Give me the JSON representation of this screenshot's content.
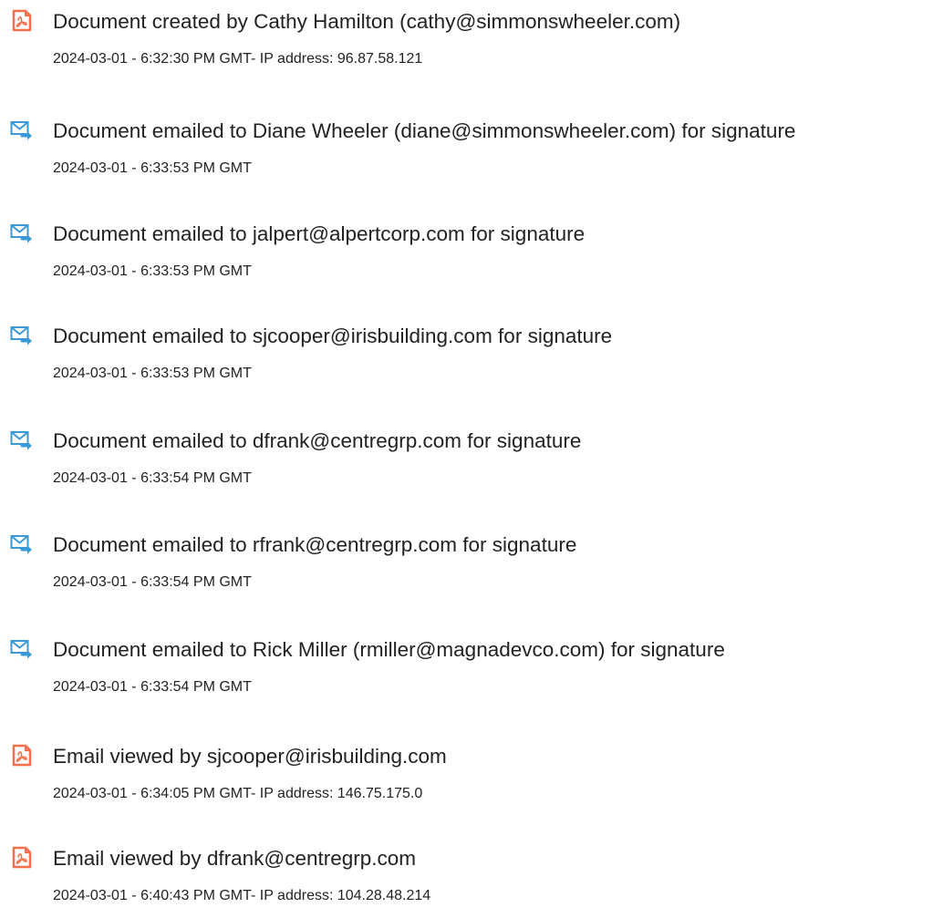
{
  "colors": {
    "doc_icon": "#f36f4a",
    "email_icon": "#3a9ad9",
    "text": "#222222"
  },
  "entries": [
    {
      "icon": "document-icon",
      "title": "Document created by Cathy Hamilton (cathy@simmonswheeler.com)",
      "meta": "2024-03-01 - 6:32:30 PM GMT- IP address: 96.87.58.121"
    },
    {
      "icon": "email-sent-icon",
      "title": "Document emailed to Diane Wheeler (diane@simmonswheeler.com) for signature",
      "meta": "2024-03-01 - 6:33:53 PM GMT"
    },
    {
      "icon": "email-sent-icon",
      "title": "Document emailed to jalpert@alpertcorp.com for signature",
      "meta": "2024-03-01 - 6:33:53 PM GMT"
    },
    {
      "icon": "email-sent-icon",
      "title": "Document emailed to sjcooper@irisbuilding.com for signature",
      "meta": "2024-03-01 - 6:33:53 PM GMT"
    },
    {
      "icon": "email-sent-icon",
      "title": "Document emailed to dfrank@centregrp.com for signature",
      "meta": "2024-03-01 - 6:33:54 PM GMT"
    },
    {
      "icon": "email-sent-icon",
      "title": "Document emailed to rfrank@centregrp.com for signature",
      "meta": "2024-03-01 - 6:33:54 PM GMT"
    },
    {
      "icon": "email-sent-icon",
      "title": "Document emailed to Rick Miller (rmiller@magnadevco.com) for signature",
      "meta": "2024-03-01 - 6:33:54 PM GMT"
    },
    {
      "icon": "document-icon",
      "title": "Email viewed by sjcooper@irisbuilding.com",
      "meta": "2024-03-01 - 6:34:05 PM GMT- IP address: 146.75.175.0"
    },
    {
      "icon": "document-icon",
      "title": "Email viewed by dfrank@centregrp.com",
      "meta": "2024-03-01 - 6:40:43 PM GMT- IP address: 104.28.48.214"
    }
  ]
}
